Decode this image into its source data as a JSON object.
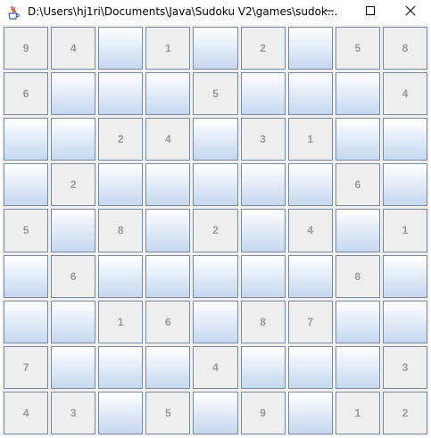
{
  "window": {
    "title": "D:\\Users\\hj1ri\\Documents\\Java\\Sudoku V2\\games\\sudok...",
    "app_icon": "java-coffee-icon",
    "controls": [
      "minimize-icon",
      "maximize-icon",
      "close-icon"
    ]
  },
  "board": {
    "rows": [
      [
        "9",
        "4",
        "",
        "1",
        "",
        "2",
        "",
        "5",
        "8"
      ],
      [
        "6",
        "",
        "",
        "",
        "5",
        "",
        "",
        "",
        "4"
      ],
      [
        "",
        "",
        "2",
        "4",
        "",
        "3",
        "1",
        "",
        ""
      ],
      [
        "",
        "2",
        "",
        "",
        "",
        "",
        "",
        "6",
        ""
      ],
      [
        "5",
        "",
        "8",
        "",
        "2",
        "",
        "4",
        "",
        "1"
      ],
      [
        "",
        "6",
        "",
        "",
        "",
        "",
        "",
        "8",
        ""
      ],
      [
        "",
        "",
        "1",
        "6",
        "",
        "8",
        "7",
        "",
        ""
      ],
      [
        "7",
        "",
        "",
        "",
        "4",
        "",
        "",
        "",
        "3"
      ],
      [
        "4",
        "3",
        "",
        "5",
        "",
        "9",
        "",
        "1",
        "2"
      ]
    ]
  },
  "colors": {
    "given_cell": "#eeeeee",
    "empty_cell_top": "#ffffff",
    "empty_cell_bottom": "#c6d7ee",
    "cell_border": "#7a8a9c",
    "digit": "#9a9a9a"
  }
}
